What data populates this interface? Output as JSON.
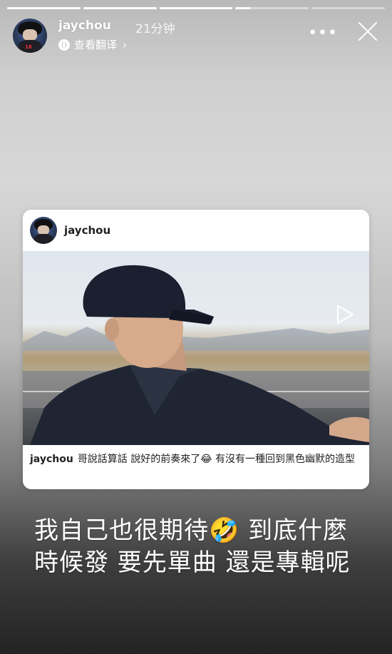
{
  "progress": {
    "segments": [
      1,
      1,
      1,
      0.2,
      0
    ]
  },
  "header": {
    "username": "jaychou",
    "time": "21分钟",
    "translate_label": "查看翻译",
    "more_symbol": "•••"
  },
  "shared_post": {
    "username": "jaychou",
    "caption_user": "jaychou",
    "caption_text": "哥說話算話 說好的前奏來了😂 有沒有一種回到黑色幽默的造型"
  },
  "overlay_text": "我自己也很期待🤣 到底什麼時候發 要先單曲 還是專輯呢",
  "colors": {
    "text_white": "#ffffff",
    "card_bg": "#ffffff",
    "caption_text": "#222222"
  },
  "icons": [
    "translate-globe-icon",
    "chevron-right-icon",
    "more-icon",
    "close-icon",
    "play-icon"
  ]
}
